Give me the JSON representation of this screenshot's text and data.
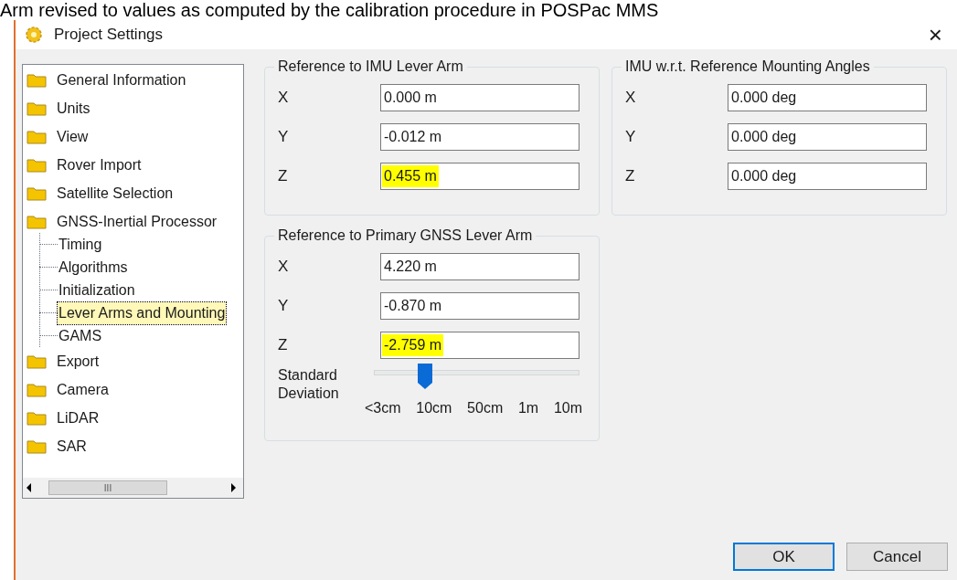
{
  "caption": "Arm revised to values as computed by the calibration procedure in POSPac MMS",
  "window": {
    "title": "Project Settings",
    "close": "×"
  },
  "tree": [
    {
      "label": "General Information",
      "selected": false
    },
    {
      "label": "Units",
      "selected": false
    },
    {
      "label": "View",
      "selected": false
    },
    {
      "label": "Rover Import",
      "selected": false
    },
    {
      "label": "Satellite Selection",
      "selected": false
    },
    {
      "label": "GNSS-Inertial Processor",
      "selected": false,
      "children": [
        {
          "label": "Timing",
          "selected": false
        },
        {
          "label": "Algorithms",
          "selected": false
        },
        {
          "label": "Initialization",
          "selected": false
        },
        {
          "label": "Lever Arms and Mounting",
          "selected": true
        },
        {
          "label": "GAMS",
          "selected": false
        }
      ]
    },
    {
      "label": "Export",
      "selected": false
    },
    {
      "label": "Camera",
      "selected": false
    },
    {
      "label": "LiDAR",
      "selected": false
    },
    {
      "label": "SAR",
      "selected": false
    }
  ],
  "tree_scrollbar": {
    "grip": "III"
  },
  "groups": [
    {
      "title": "Reference to IMU Lever Arm",
      "fields": [
        {
          "label": "X",
          "value": "0.000 m",
          "highlighted": false
        },
        {
          "label": "Y",
          "value": "-0.012 m",
          "highlighted": false
        },
        {
          "label": "Z",
          "value": "0.455 m",
          "highlighted": true
        }
      ]
    },
    {
      "title": "IMU w.r.t. Reference Mounting Angles",
      "fields": [
        {
          "label": "X",
          "value": "0.000 deg",
          "highlighted": false
        },
        {
          "label": "Y",
          "value": "0.000 deg",
          "highlighted": false
        },
        {
          "label": "Z",
          "value": "0.000 deg",
          "highlighted": false
        }
      ]
    },
    {
      "title": "Reference to Primary GNSS Lever Arm",
      "fields": [
        {
          "label": "X",
          "value": "4.220 m",
          "highlighted": false
        },
        {
          "label": "Y",
          "value": "-0.870 m",
          "highlighted": false
        },
        {
          "label": "Z",
          "value": "-2.759 m",
          "highlighted": true
        }
      ],
      "slider": {
        "label": "Standard Deviation",
        "level": 0.25,
        "ticks": [
          "<3cm",
          "10cm",
          "50cm",
          "1m",
          "10m"
        ]
      }
    }
  ],
  "buttons": [
    {
      "label": "OK",
      "default": true
    },
    {
      "label": "Cancel",
      "default": false
    }
  ]
}
